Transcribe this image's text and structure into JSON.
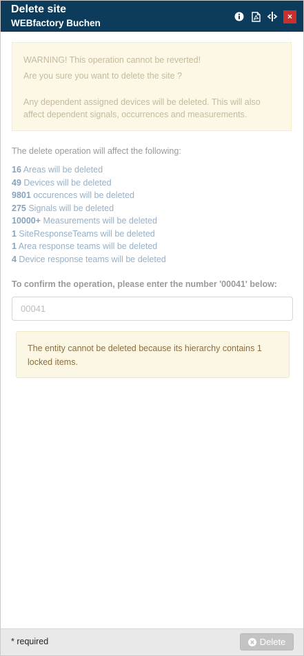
{
  "header": {
    "title": "Delete site",
    "subtitle": "WEBfactory Buchen",
    "close_label": "×"
  },
  "warning": {
    "line1": "WARNING! This operation cannot be reverted!",
    "line2": "Are you sure you want to delete the site ?",
    "line3": "Any dependent assigned devices will be deleted. This will also affect dependent signals, occurrences and measurements."
  },
  "affect": {
    "title": "The delete operation will affect the following:",
    "items": [
      {
        "count": "16",
        "text": " Areas will be deleted"
      },
      {
        "count": "49",
        "text": " Devices will be deleted"
      },
      {
        "count": "9801",
        "text": " occurences will be deleted"
      },
      {
        "count": "275",
        "text": " Signals will be deleted"
      },
      {
        "count": "10000+",
        "text": " Measurements will be deleted"
      },
      {
        "count": "1",
        "text": " SiteResponseTeams will be deleted"
      },
      {
        "count": "1",
        "text": " Area response teams will be deleted"
      },
      {
        "count": "4",
        "text": " Device response teams will be deleted"
      }
    ]
  },
  "confirm": {
    "label": "To confirm the operation, please enter the number '00041' below:",
    "placeholder": "00041",
    "value": ""
  },
  "locked_message": "The entity cannot be deleted because its hierarchy contains 1 locked items.",
  "footer": {
    "required_label": "* required",
    "delete_label": "Delete"
  },
  "colors": {
    "header_bg": "#0c3b5b",
    "close_red": "#c9302c",
    "warning_bg": "#fdf8e6",
    "alert_bg": "#fcf7e5",
    "disabled_button": "#c3c3c3"
  }
}
